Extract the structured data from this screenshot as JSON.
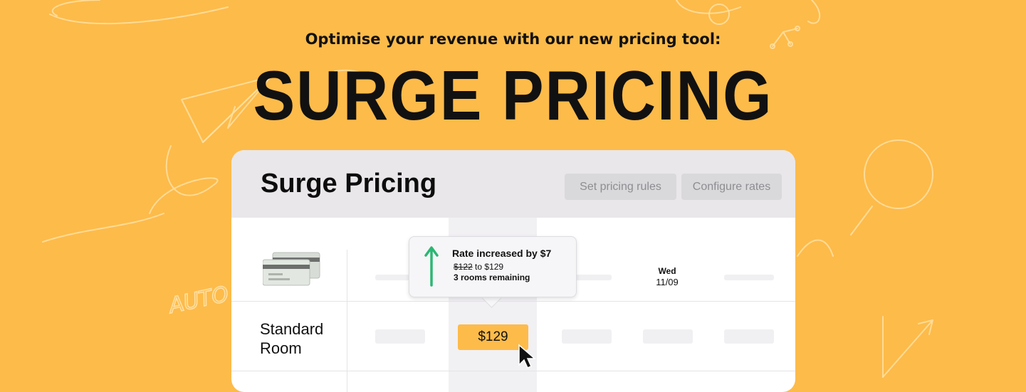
{
  "banner": {
    "tagline": "Optimise your revenue with our new pricing tool:",
    "title": "SURGE PRICING",
    "background_color": "#FDBB4A"
  },
  "panel": {
    "title": "Surge Pricing",
    "buttons": {
      "set_pricing_rules": "Set pricing rules",
      "configure_rates": "Configure rates"
    },
    "column": {
      "day": "Wed",
      "date": "11/09"
    },
    "room": {
      "name": "Standard Room",
      "price": "$129",
      "price_chip_color": "#FDBB4A"
    },
    "tooltip": {
      "title": "Rate increased by $7",
      "old_rate": "$122",
      "to_text": "to $129",
      "rooms_remaining": "3 rooms remaining",
      "icon": "up-arrow-icon",
      "arrow_color": "#2BB673"
    },
    "icons": {
      "cards": "credit-cards-icon",
      "cursor": "mouse-pointer-icon"
    }
  }
}
